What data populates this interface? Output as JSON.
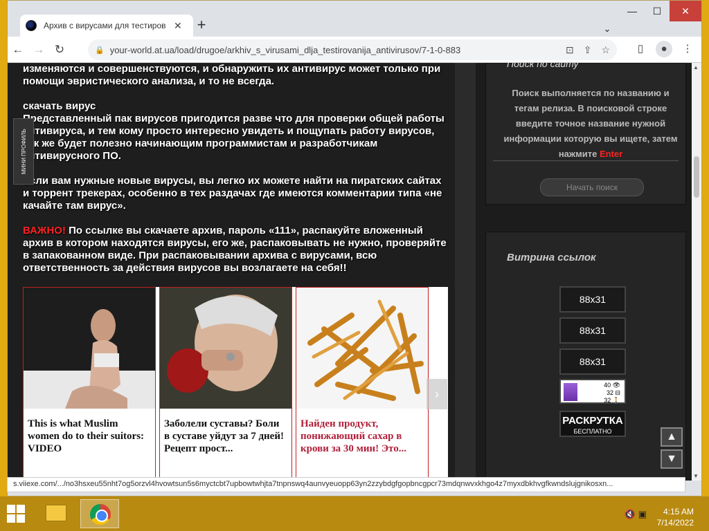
{
  "browser": {
    "tab_title": "Архив с вирусами для тестиров",
    "url": "your-world.at.ua/load/drugoe/arkhiv_s_virusami_dlja_testirovanija_antivirusov/7-1-0-883",
    "status_url": "s.viiexe.com/.../no3hsxeu55nht7og5orzvl4hvowtsun5s6myctcbt7upbowtwhjta7tnpnswq4aunvyeuopp63yn2zzybdgfgopbncgpcr73mdqnwvxkhgo4z7myxdbkhvgfkwndslujgnikosxn...",
    "new_tab": "+",
    "close_tab": "✕"
  },
  "article": {
    "p1": "изменяются и совершенствуются, и обнаружить их антивирус может только при помощи эвристического анализа, и то не всегда.",
    "download_heading": "скачать вирус",
    "p2": "Представленный пак вирусов пригодится разве что для проверки общей работы антивируса, и тем кому просто интересно увидеть и пощупать работу вирусов, так же будет полезно начинающим программистам и разработчикам антивирусного ПО.",
    "p3": "Если вам нужные новые вирусы, вы легко их можете найти на пиратских сайтах и торрент трекерах, особенно в тех раздачах где имеются комментарии типа «не качайте там вирус».",
    "important_label": "ВАЖНО!",
    "p4": " По ссылке вы скачаете архив, пароль «111», распакуйте вложенный архив в котором находятся вирусы, его же, распаковывать не нужно, проверяйте в запакованном виде. При распаковывании архива с вирусами, всю ответственность за действия вирусов вы возлагаете на себя!!"
  },
  "mini_profile": "МИНИ ПРОФИЛЬ",
  "ads": [
    {
      "text": "This is what Muslim women do to their suitors: VIDEO"
    },
    {
      "text": "Заболели суставы? Боли в суставе уйдут за 7 дней! Рецепт прост..."
    },
    {
      "text": "Найден продукт, понижающий сахар в крови за 30 мин! Это..."
    }
  ],
  "sidebar": {
    "search_title": "Поиск по сайту",
    "search_text": "Поиск выполняется по названию и тегам релиза. В поисковой строке введите точное название нужной информации которую вы ищете, затем нажмите ",
    "search_enter": "Enter",
    "search_button": "Начать поиск",
    "links_title": "Витрина ссылок",
    "banners": [
      "88x31",
      "88x31",
      "88x31"
    ],
    "counter": [
      "40 👁",
      "32 ⊟",
      "32 🚶"
    ],
    "raskrutka_big": "РАСКРУТКА",
    "raskrutka_small": "БЕСПЛАТНО"
  },
  "taskbar": {
    "time": "4:15 AM",
    "date": "7/14/2022"
  }
}
